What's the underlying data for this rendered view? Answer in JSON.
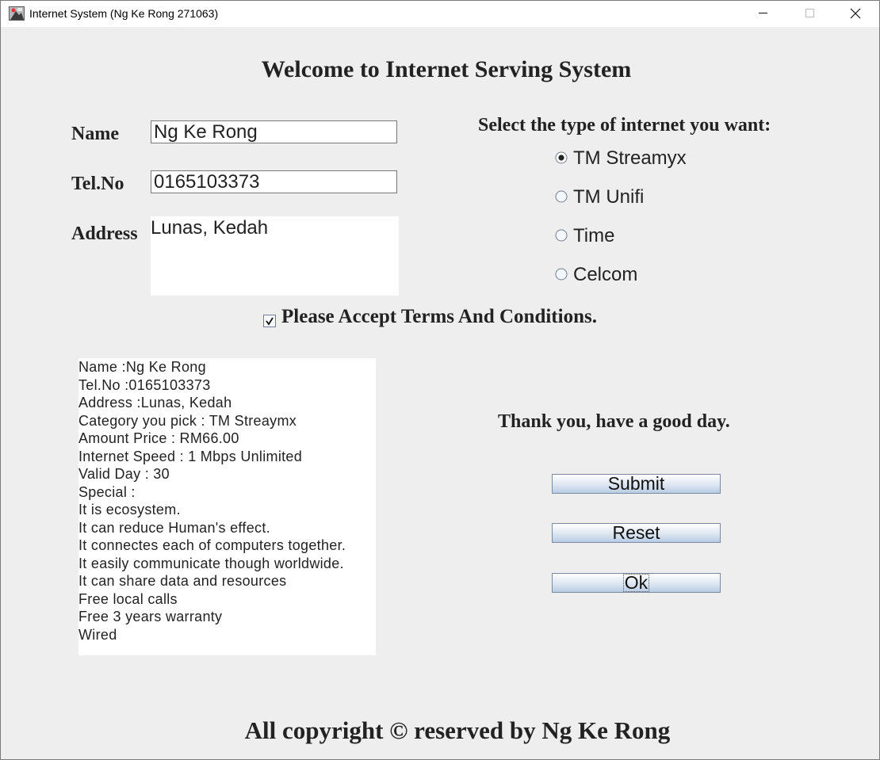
{
  "window": {
    "title": "Internet System (Ng Ke Rong 271063)"
  },
  "heading": "Welcome to Internet Serving System",
  "form": {
    "name_label": "Name",
    "name_value": "Ng Ke Rong",
    "tel_label": "Tel.No",
    "tel_value": "0165103373",
    "address_label": "Address",
    "address_value": "Lunas, Kedah"
  },
  "internet_type": {
    "label": "Select the type of internet you want:",
    "options": [
      {
        "label": "TM Streamyx",
        "selected": true
      },
      {
        "label": "TM Unifi",
        "selected": false
      },
      {
        "label": "Time",
        "selected": false
      },
      {
        "label": "Celcom",
        "selected": false
      }
    ]
  },
  "terms": {
    "label": "Please Accept Terms And Conditions.",
    "checked": true
  },
  "summary": {
    "lines": [
      "Name :Ng Ke Rong",
      "Tel.No :0165103373",
      "Address :Lunas, Kedah",
      "Category you pick : TM Streaymx",
      "Amount Price : RM66.00",
      "Internet Speed : 1 Mbps Unlimited",
      "Valid Day : 30",
      "Special :",
      "It is ecosystem.",
      "It can reduce Human's effect.",
      "It connectes each of computers together.",
      "It easily communicate though worldwide.",
      "It can share data and resources",
      "Free local calls",
      "Free 3 years warranty",
      "Wired"
    ]
  },
  "thanks": "Thank you, have a good day.",
  "buttons": {
    "submit": "Submit",
    "reset": "Reset",
    "ok": "Ok"
  },
  "footer": "All copyright © reserved by Ng Ke Rong",
  "icons": {
    "app": "java-app-icon",
    "minimize": "minimize-icon",
    "maximize": "maximize-icon",
    "close": "close-icon"
  },
  "colors": {
    "background": "#eeeeee",
    "text": "#222222",
    "button_gradient_bottom": "#b8cce4"
  }
}
